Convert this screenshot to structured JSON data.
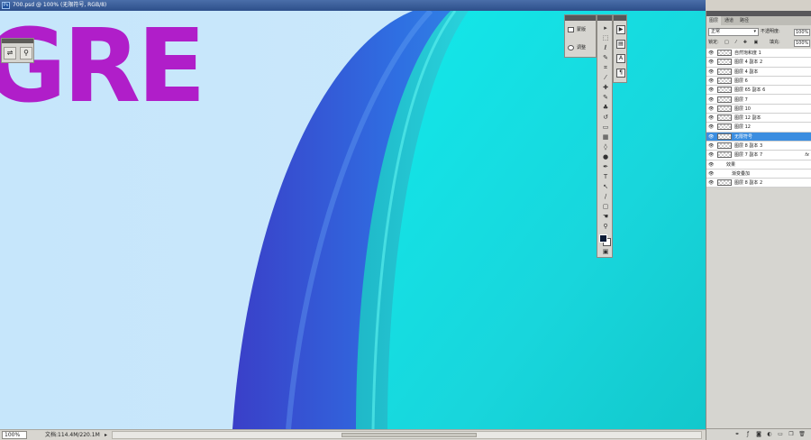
{
  "window": {
    "title": "700.psd @ 100% (无限符号, RGB/8)",
    "icon": "ps-icon"
  },
  "canvas": {
    "text": "GRE",
    "text_color": "#b01ec9",
    "background": "#c6e6fb"
  },
  "statusbar": {
    "zoom": "100%",
    "doc_info": "文档:114.4M/220.1M"
  },
  "adjust_panel": {
    "items": [
      {
        "label": "蒙版",
        "icon": "mask-icon"
      },
      {
        "label": "调整",
        "icon": "adjust-icon"
      }
    ]
  },
  "tools": [
    {
      "name": "move-tool",
      "glyph": "▸"
    },
    {
      "name": "marquee-tool",
      "glyph": "⬚"
    },
    {
      "name": "lasso-tool",
      "glyph": "ℓ"
    },
    {
      "name": "quick-select-tool",
      "glyph": "✎"
    },
    {
      "name": "crop-tool",
      "glyph": "⌗"
    },
    {
      "name": "eyedropper-tool",
      "glyph": "⁄"
    },
    {
      "name": "healing-tool",
      "glyph": "✚"
    },
    {
      "name": "brush-tool",
      "glyph": "✎"
    },
    {
      "name": "stamp-tool",
      "glyph": "♣"
    },
    {
      "name": "history-brush-tool",
      "glyph": "↺"
    },
    {
      "name": "eraser-tool",
      "glyph": "▭"
    },
    {
      "name": "gradient-tool",
      "glyph": "▦"
    },
    {
      "name": "blur-tool",
      "glyph": "◊"
    },
    {
      "name": "dodge-tool",
      "glyph": "●"
    },
    {
      "name": "pen-tool",
      "glyph": "✒"
    },
    {
      "name": "type-tool",
      "glyph": "T"
    },
    {
      "name": "path-select-tool",
      "glyph": "↖"
    },
    {
      "name": "line-tool",
      "glyph": "∕"
    },
    {
      "name": "shape-tool",
      "glyph": "▢"
    },
    {
      "name": "hand-tool",
      "glyph": "☚"
    },
    {
      "name": "zoom-tool",
      "glyph": "⚲"
    }
  ],
  "side_icons": [
    {
      "name": "play-icon",
      "glyph": "▶"
    },
    {
      "name": "grid-icon",
      "glyph": "▤"
    },
    {
      "name": "character-icon",
      "glyph": "A"
    },
    {
      "name": "paragraph-icon",
      "glyph": "¶"
    }
  ],
  "layers_panel": {
    "tabs": [
      "图层",
      "通道",
      "路径"
    ],
    "blend_mode": "正常",
    "opacity_label": "不透明度:",
    "opacity": "100%",
    "lock_label": "锁定:",
    "fill_label": "填充:",
    "fill": "100%",
    "layers": [
      {
        "name": "自然饱和度 1",
        "fx": "",
        "selected": false,
        "indent": false
      },
      {
        "name": "图层 4 副本 2",
        "fx": "",
        "selected": false,
        "indent": false
      },
      {
        "name": "图层 4 副本",
        "fx": "",
        "selected": false,
        "indent": false
      },
      {
        "name": "图层 6",
        "fx": "",
        "selected": false,
        "indent": false
      },
      {
        "name": "图层 65 副本 6",
        "fx": "",
        "selected": false,
        "indent": false
      },
      {
        "name": "图层 7",
        "fx": "",
        "selected": false,
        "indent": false
      },
      {
        "name": "图层 10",
        "fx": "",
        "selected": false,
        "indent": false
      },
      {
        "name": "图层 12 副本",
        "fx": "",
        "selected": false,
        "indent": false
      },
      {
        "name": "图层 12",
        "fx": "",
        "selected": false,
        "indent": false
      },
      {
        "name": "无限符号",
        "fx": "",
        "selected": true,
        "indent": false
      },
      {
        "name": "图层 8 副本 3",
        "fx": "",
        "selected": false,
        "indent": false
      },
      {
        "name": "图层 7 副本 7",
        "fx": "fx",
        "selected": false,
        "indent": false
      },
      {
        "name": "效果",
        "fx": "",
        "selected": false,
        "indent": true
      },
      {
        "name": "渐变叠加",
        "fx": "",
        "selected": false,
        "indent": true
      },
      {
        "name": "图层 8 副本 2",
        "fx": "",
        "selected": false,
        "indent": false
      }
    ],
    "footer": [
      "link-icon",
      "fx-icon",
      "mask-icon",
      "adjust-icon",
      "folder-icon",
      "new-layer-icon",
      "trash-icon"
    ]
  }
}
